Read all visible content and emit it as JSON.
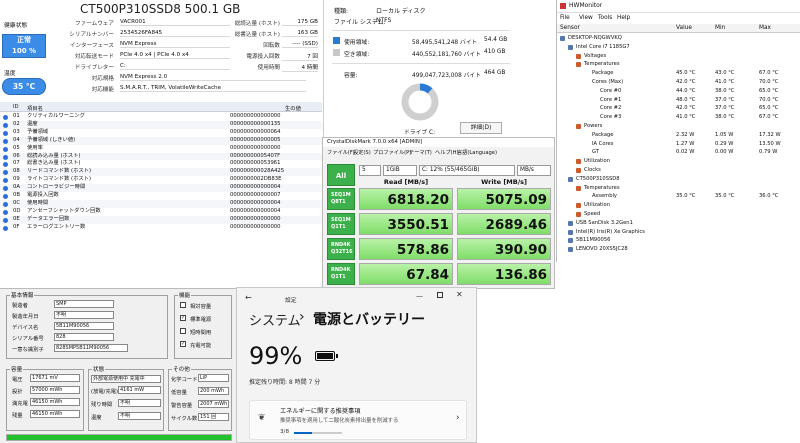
{
  "crystaldiskinfo": {
    "title": "CT500P310SSD8 500.1 GB",
    "health_label": "健康状態",
    "health_status": "正常",
    "health_percent": "100 %",
    "temp_label": "温度",
    "temp_value": "35 °C",
    "left_fields": [
      {
        "label": "ファームウェア",
        "value": "VACR001"
      },
      {
        "label": "シリアルナンバー",
        "value": "2534526FA845"
      },
      {
        "label": "インターフェース",
        "value": "NVM Express"
      },
      {
        "label": "対応転送モード",
        "value": "PCIe 4.0 x4 | PCIe 4.0 x4"
      },
      {
        "label": "ドライブレター",
        "value": "C:"
      },
      {
        "label": "対応規格",
        "value": "NVM Express 2.0"
      },
      {
        "label": "対応機能",
        "value": "S.M.A.R.T., TRIM, VolatileWriteCache"
      }
    ],
    "right_fields": [
      {
        "label": "総読込量 (ホスト)",
        "value": "175 GB"
      },
      {
        "label": "総書込量 (ホスト)",
        "value": "163 GB"
      },
      {
        "label": "回転数",
        "value": "---- (SSD)"
      },
      {
        "label": "電源投入回数",
        "value": "7 回"
      },
      {
        "label": "使用時間",
        "value": "4 時間"
      }
    ],
    "col_id": "ID",
    "col_name": "項目名",
    "col_raw": "生の値",
    "attributes": [
      {
        "id": "01",
        "name": "クリティカルワーニング",
        "raw": "000000000000000"
      },
      {
        "id": "02",
        "name": "温度",
        "raw": "000000000000135"
      },
      {
        "id": "03",
        "name": "予備領域",
        "raw": "000000000000064"
      },
      {
        "id": "04",
        "name": "予備領域 (しきい値)",
        "raw": "000000000000005"
      },
      {
        "id": "05",
        "name": "使用率",
        "raw": "000000000000000"
      },
      {
        "id": "06",
        "name": "総読み込み量 (ホスト)",
        "raw": "00000000005407F"
      },
      {
        "id": "07",
        "name": "総書き込み量 (ホスト)",
        "raw": "000000000053961"
      },
      {
        "id": "08",
        "name": "リードコマンド数 (ホスト)",
        "raw": "000000000028A425"
      },
      {
        "id": "09",
        "name": "ライトコマンド数 (ホスト)",
        "raw": "0000000002DB83E"
      },
      {
        "id": "0A",
        "name": "コントローラビジー時間",
        "raw": "000000000000004"
      },
      {
        "id": "0B",
        "name": "電源投入回数",
        "raw": "000000000000007"
      },
      {
        "id": "0C",
        "name": "使用時間",
        "raw": "000000000000004"
      },
      {
        "id": "0D",
        "name": "アンセーフシャットダウン回数",
        "raw": "000000000000004"
      },
      {
        "id": "0E",
        "name": "データエラー回数",
        "raw": "000000000000000"
      },
      {
        "id": "0F",
        "name": "エラーログエントリー数",
        "raw": "000000000000000"
      }
    ]
  },
  "explorer": {
    "type_label": "種類:",
    "type_value": "ローカル ディスク",
    "fs_label": "ファイル システム:",
    "fs_value": "NTFS",
    "used_label": "使用領域:",
    "used_bytes": "58,495,541,248 バイト",
    "used_size": "54.4 GB",
    "free_label": "空き領域:",
    "free_bytes": "440,552,181,760 バイト",
    "free_size": "410 GB",
    "cap_label": "容量:",
    "cap_bytes": "499,047,723,008 バイト",
    "cap_size": "464 GB",
    "drive_label": "ドライブ C:",
    "detail_button": "詳細(D)",
    "used_fraction": 0.117
  },
  "hwmonitor": {
    "title": "HWMonitor",
    "menu": [
      "File",
      "View",
      "Tools",
      "Help"
    ],
    "columns": [
      "Sensor",
      "Value",
      "Min",
      "Max"
    ],
    "rows": [
      {
        "indent": 0,
        "name": "DESKTOP-NQGWVKQ",
        "v": "",
        "mn": "",
        "mx": ""
      },
      {
        "indent": 1,
        "name": "Intel Core i7 1185G7",
        "v": "",
        "mn": "",
        "mx": ""
      },
      {
        "indent": 2,
        "name": "Voltages",
        "v": "",
        "mn": "",
        "mx": ""
      },
      {
        "indent": 2,
        "name": "Temperatures",
        "v": "",
        "mn": "",
        "mx": ""
      },
      {
        "indent": 3,
        "name": "Package",
        "v": "45.0 °C",
        "mn": "43.0 °C",
        "mx": "67.0 °C"
      },
      {
        "indent": 3,
        "name": "Cores (Max)",
        "v": "42.0 °C",
        "mn": "41.0 °C",
        "mx": "70.0 °C"
      },
      {
        "indent": 4,
        "name": "Core #0",
        "v": "44.0 °C",
        "mn": "38.0 °C",
        "mx": "65.0 °C"
      },
      {
        "indent": 4,
        "name": "Core #1",
        "v": "48.0 °C",
        "mn": "37.0 °C",
        "mx": "70.0 °C"
      },
      {
        "indent": 4,
        "name": "Core #2",
        "v": "42.0 °C",
        "mn": "37.0 °C",
        "mx": "65.0 °C"
      },
      {
        "indent": 4,
        "name": "Core #3",
        "v": "41.0 °C",
        "mn": "38.0 °C",
        "mx": "67.0 °C"
      },
      {
        "indent": 2,
        "name": "Powers",
        "v": "",
        "mn": "",
        "mx": ""
      },
      {
        "indent": 3,
        "name": "Package",
        "v": "2.32 W",
        "mn": "1.05 W",
        "mx": "17.32 W"
      },
      {
        "indent": 3,
        "name": "IA Cores",
        "v": "1.27 W",
        "mn": "0.29 W",
        "mx": "13.50 W"
      },
      {
        "indent": 3,
        "name": "GT",
        "v": "0.02 W",
        "mn": "0.00 W",
        "mx": "0.79 W"
      },
      {
        "indent": 2,
        "name": "Utilization",
        "v": "",
        "mn": "",
        "mx": ""
      },
      {
        "indent": 2,
        "name": "Clocks",
        "v": "",
        "mn": "",
        "mx": ""
      },
      {
        "indent": 1,
        "name": "CT500P310SSD8",
        "v": "",
        "mn": "",
        "mx": ""
      },
      {
        "indent": 2,
        "name": "Temperatures",
        "v": "",
        "mn": "",
        "mx": ""
      },
      {
        "indent": 3,
        "name": "Assembly",
        "v": "35.0 °C",
        "mn": "35.0 °C",
        "mx": "36.0 °C"
      },
      {
        "indent": 2,
        "name": "Utilization",
        "v": "",
        "mn": "",
        "mx": ""
      },
      {
        "indent": 2,
        "name": "Speed",
        "v": "",
        "mn": "",
        "mx": ""
      },
      {
        "indent": 1,
        "name": "USB  SanDisk 3.2Gen1",
        "v": "",
        "mn": "",
        "mx": ""
      },
      {
        "indent": 1,
        "name": "Intel(R) Iris(R) Xe Graphics",
        "v": "",
        "mn": "",
        "mx": ""
      },
      {
        "indent": 1,
        "name": "5B11M90056",
        "v": "",
        "mn": "",
        "mx": ""
      },
      {
        "indent": 1,
        "name": "LENOVO 20XS5JC28",
        "v": "",
        "mn": "",
        "mx": ""
      }
    ]
  },
  "crystaldiskmark": {
    "title": "CrystalDiskMark 7.0.0 x64 [ADMIN]",
    "menu": [
      "ファイル(F)",
      "設定(S)",
      "プロファイル(P)",
      "テーマ(T)",
      "ヘルプ(H)",
      "言語(Language)"
    ],
    "all_button": "All",
    "count": "5",
    "size": "1GiB",
    "drive": "C: 12% (55/465GiB)",
    "unit": "MB/s",
    "read_header": "Read [MB/s]",
    "write_header": "Write [MB/s]",
    "rows": [
      {
        "l1": "SEQ1M",
        "l2": "Q8T1",
        "read": "6818.20",
        "write": "5075.09"
      },
      {
        "l1": "SEQ1M",
        "l2": "Q1T1",
        "read": "3550.51",
        "write": "2689.46"
      },
      {
        "l1": "RND4K",
        "l2": "Q32T16",
        "read": "578.86",
        "write": "390.90"
      },
      {
        "l1": "RND4K",
        "l2": "Q1T1",
        "read": "67.84",
        "write": "136.86"
      }
    ]
  },
  "battery_info": {
    "basic_title": "基本情報",
    "basic_fields": [
      {
        "label": "製造者",
        "value": "SMP"
      },
      {
        "label": "製造年月日",
        "value": "不明"
      },
      {
        "label": "デバイス名",
        "value": "5B11M90056"
      },
      {
        "label": "シリアル番号",
        "value": "828"
      },
      {
        "label": "一意な識別子",
        "value": "828SMP5B11M90056"
      }
    ],
    "func_title": "機能",
    "func_items": [
      {
        "label": "相対容量",
        "checked": false
      },
      {
        "label": "標準電源",
        "checked": true
      },
      {
        "label": "短時間用",
        "checked": false
      },
      {
        "label": "充電可能",
        "checked": true
      }
    ],
    "cap_title": "容量",
    "cap_fields": [
      {
        "label": "電圧",
        "value": "17671 mV"
      },
      {
        "label": "設計",
        "value": "57000 mWh"
      },
      {
        "label": "満充電",
        "value": "46150 mWh"
      },
      {
        "label": "残量",
        "value": "46150 mWh"
      }
    ],
    "status_title": "状態",
    "status_value": "外部電源使用中 充電中",
    "status_fields": [
      {
        "label": "(放電/充電)速度",
        "value": "4161 mW"
      },
      {
        "label": "残り時間",
        "value": "不明"
      },
      {
        "label": "温度",
        "value": "不明"
      }
    ],
    "other_title": "その他",
    "other_fields": [
      {
        "label": "化学コード",
        "value": "LiP"
      },
      {
        "label": "低容量",
        "value": "200 mWh"
      },
      {
        "label": "警告容量",
        "value": "2007 mWh"
      },
      {
        "label": "サイクル数",
        "value": "151 回"
      }
    ],
    "charge_fraction": 1.0
  },
  "settings": {
    "back_icon": "←",
    "app_label": "設定",
    "breadcrumb_parent": "システム",
    "breadcrumb_sep": "›",
    "breadcrumb_current": "電源とバッテリー",
    "percent": "99%",
    "remaining": "推定残り時間: 8 時間 7 分",
    "rec_title": "エネルギーに関する推奨事項",
    "rec_subtitle": "推奨事項を適用して二酸化炭素排出量を削減する",
    "progress_text": "3/8",
    "progress_fraction": 0.375
  }
}
